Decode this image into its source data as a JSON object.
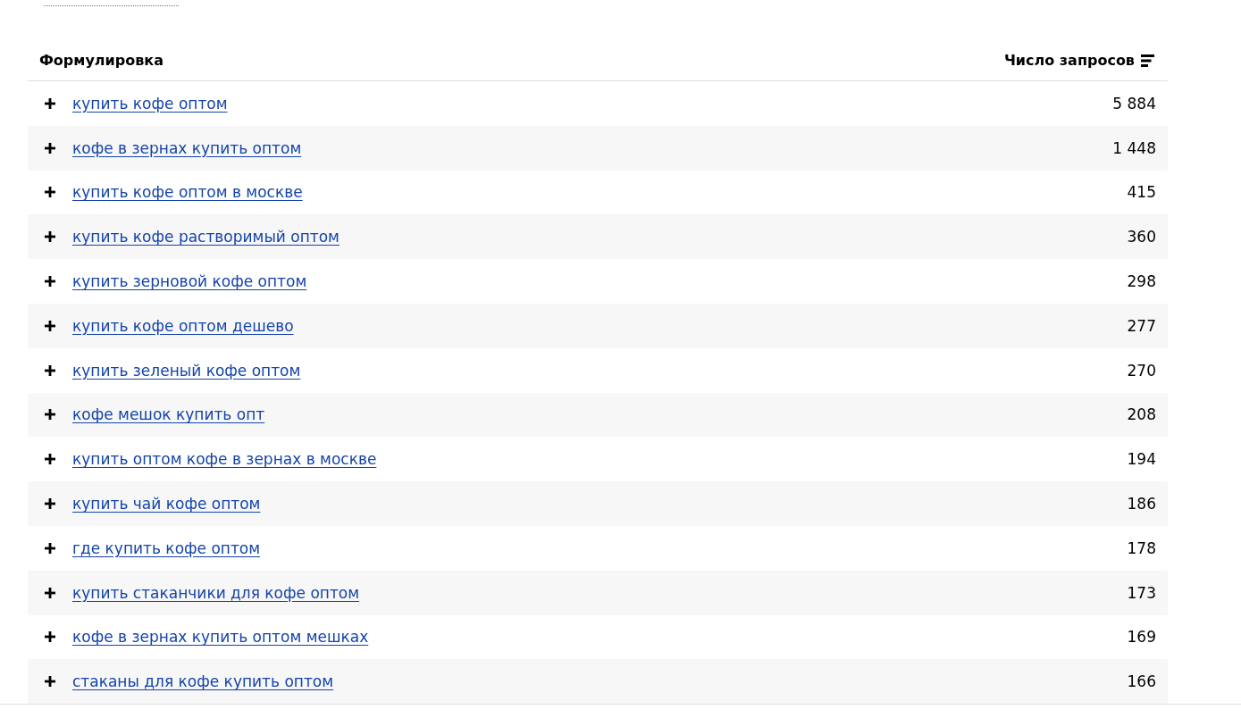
{
  "table": {
    "columns": [
      {
        "label": "Формулировка",
        "sorted": false
      },
      {
        "label": "Число запросов",
        "sorted": true
      }
    ],
    "rows": [
      {
        "phrase": "купить кофе оптом",
        "count": "5 884"
      },
      {
        "phrase": "кофе в зернах купить оптом",
        "count": "1 448"
      },
      {
        "phrase": "купить кофе оптом в москве",
        "count": "415"
      },
      {
        "phrase": "купить кофе растворимый оптом",
        "count": "360"
      },
      {
        "phrase": "купить зерновой кофе оптом",
        "count": "298"
      },
      {
        "phrase": "купить кофе оптом дешево",
        "count": "277"
      },
      {
        "phrase": "купить зеленый кофе оптом",
        "count": "270"
      },
      {
        "phrase": "кофе мешок купить опт",
        "count": "208"
      },
      {
        "phrase": "купить оптом кофе в зернах в москве",
        "count": "194"
      },
      {
        "phrase": "купить чай кофе оптом",
        "count": "186"
      },
      {
        "phrase": "где купить кофе оптом",
        "count": "178"
      },
      {
        "phrase": "купить стаканчики для кофе оптом",
        "count": "173"
      },
      {
        "phrase": "кофе в зернах купить оптом мешках",
        "count": "169"
      },
      {
        "phrase": "стаканы для кофе купить оптом",
        "count": "166"
      }
    ]
  }
}
